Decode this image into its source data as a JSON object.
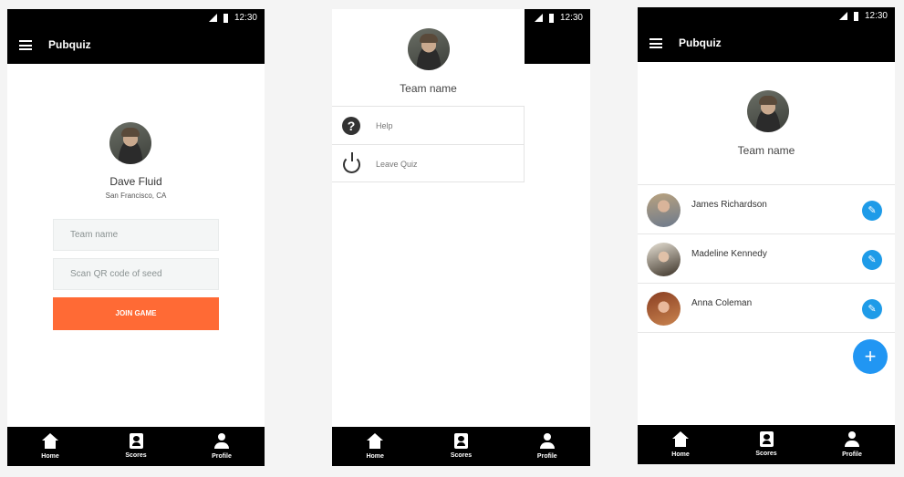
{
  "status_time": "12:30",
  "screen1": {
    "app_title": "Pubquiz",
    "user_name": "Dave Fluid",
    "user_location": "San Francisco, CA",
    "team_name_placeholder": "Team name",
    "qr_placeholder": "Scan QR code of seed",
    "join_button": "JOIN GAME"
  },
  "screen2": {
    "team_name": "Team name",
    "menu": [
      {
        "label": "Help",
        "icon": "help-icon"
      },
      {
        "label": "Leave Quiz",
        "icon": "power-icon"
      }
    ]
  },
  "screen3": {
    "app_title": "Pubquiz",
    "team_name": "Team name",
    "members": [
      {
        "name": "James Richardson"
      },
      {
        "name": "Madeline Kennedy"
      },
      {
        "name": "Anna Coleman"
      }
    ],
    "fab_label": "+"
  },
  "bottom_nav": [
    {
      "label": "Home",
      "icon": "home-icon"
    },
    {
      "label": "Scores",
      "icon": "scores-icon"
    },
    {
      "label": "Profile",
      "icon": "profile-icon"
    }
  ],
  "colors": {
    "accent_orange": "#ff6a35",
    "edit_blue": "#1e9be8",
    "fab_blue": "#2196f3",
    "bar_black": "#000000"
  }
}
